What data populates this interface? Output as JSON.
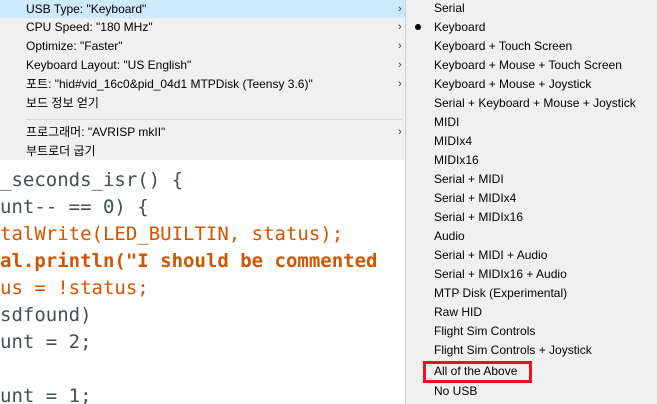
{
  "tools_menu": {
    "items": [
      {
        "label": "USB Type: \"Keyboard\"",
        "has_submenu": true,
        "highlighted": true
      },
      {
        "label": "CPU Speed: \"180 MHz\"",
        "has_submenu": true
      },
      {
        "label": "Optimize: \"Faster\"",
        "has_submenu": true
      },
      {
        "label": "Keyboard Layout: \"US English\"",
        "has_submenu": true
      },
      {
        "label": "포트: \"hid#vid_16c0&pid_04d1 MTPDisk (Teensy 3.6)\"",
        "has_submenu": true
      },
      {
        "label": "보드 정보 얻기",
        "has_submenu": false
      },
      {
        "label": "프로그래머: \"AVRISP mkII\"",
        "has_submenu": true
      },
      {
        "label": "부트로더 굽기",
        "has_submenu": false
      }
    ],
    "arrow_glyph": "›"
  },
  "code_editor": {
    "lines": [
      "_seconds_isr() {",
      "unt-- == 0) {",
      "talWrite(LED_BUILTIN, status);",
      "al.println(\"I should be commented",
      "us = !status;",
      "sdfound)",
      "unt = 2;",
      "",
      "unt = 1;"
    ]
  },
  "usb_submenu": {
    "selected": "Keyboard",
    "highlighted_with_red_box": "All of the Above",
    "items": [
      "Serial",
      "Keyboard",
      "Keyboard + Touch Screen",
      "Keyboard + Mouse + Touch Screen",
      "Keyboard + Mouse + Joystick",
      "Serial + Keyboard + Mouse + Joystick",
      "MIDI",
      "MIDIx4",
      "MIDIx16",
      "Serial + MIDI",
      "Serial + MIDIx4",
      "Serial + MIDIx16",
      "Audio",
      "Serial + MIDI + Audio",
      "Serial + MIDIx16 + Audio",
      "MTP Disk (Experimental)",
      "Raw HID",
      "Flight Sim Controls",
      "Flight Sim Controls + Joystick",
      "All of the Above",
      "No USB"
    ]
  },
  "colors": {
    "menu_bg": "#f0f0f0",
    "highlight": "#cde8ff",
    "red_box": "#e8141c",
    "code_keyword": "#d35400",
    "code_constant": "#00979c",
    "code_string": "#005c5f"
  }
}
